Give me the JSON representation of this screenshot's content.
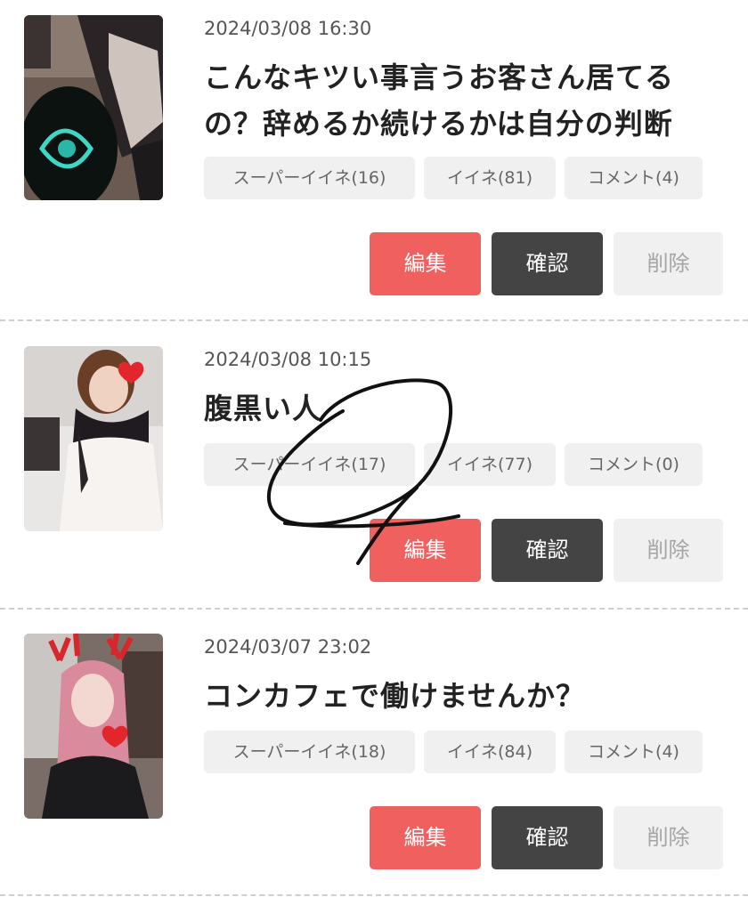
{
  "posts": [
    {
      "date": "2024/03/08 16:30",
      "title": "こんなキツい事言うお客さん居てるの？辞めるか続けるかは自分の判断",
      "super_like": "スーパーイイネ(16)",
      "like": "イイネ(81)",
      "comment": "コメント(4)",
      "edit": "編集",
      "confirm": "確認",
      "delete": "削除"
    },
    {
      "date": "2024/03/08 10:15",
      "title": "腹黒い人",
      "super_like": "スーパーイイネ(17)",
      "like": "イイネ(77)",
      "comment": "コメント(0)",
      "edit": "編集",
      "confirm": "確認",
      "delete": "削除"
    },
    {
      "date": "2024/03/07 23:02",
      "title": "コンカフェで働けませんか？",
      "super_like": "スーパーイイネ(18)",
      "like": "イイネ(84)",
      "comment": "コメント(4)",
      "edit": "編集",
      "confirm": "確認",
      "delete": "削除"
    }
  ],
  "colors": {
    "edit_button": "#f0605f",
    "confirm_button": "#444444",
    "delete_button": "#f0f0f0",
    "chip": "#f0f0f0",
    "divider": "#cfcfcf",
    "scribble": "#111111"
  }
}
